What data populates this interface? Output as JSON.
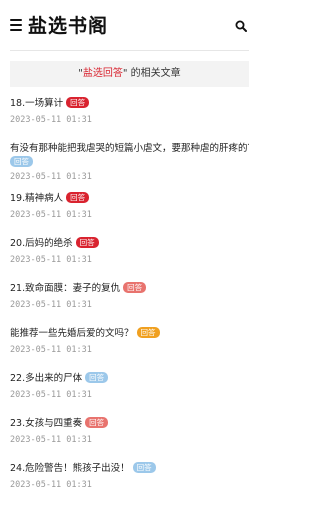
{
  "header": {
    "title": "盐选书阁"
  },
  "banner": {
    "prefix": "\"",
    "keyword": "盐选回答",
    "suffix": "\" 的相关文章"
  },
  "items": [
    {
      "title": "18.一场算计",
      "badge": "回答",
      "badge_color": "#d9232f",
      "date": "2023-05-11 01:31"
    },
    {
      "title": "有没有那种能把我虐哭的短篇小虐文，要那种虐的肝疼的？",
      "badge": "回答",
      "badge_color": "#9cc8ea",
      "date": "2023-05-11 01:31"
    },
    {
      "title": "19.精神病人",
      "badge": "回答",
      "badge_color": "#d9232f",
      "date": "2023-05-11 01:31"
    },
    {
      "title": "20.后妈的绝杀",
      "badge": "回答",
      "badge_color": "#d9232f",
      "date": "2023-05-11 01:31"
    },
    {
      "title": "21.致命面膜：妻子的复仇",
      "badge": "回答",
      "badge_color": "#e8736e",
      "date": "2023-05-11 01:31"
    },
    {
      "title": "能推荐一些先婚后爱的文吗？",
      "badge": "回答",
      "badge_color": "#f0a020",
      "date": "2023-05-11 01:31"
    },
    {
      "title": "22.多出来的尸体",
      "badge": "回答",
      "badge_color": "#9cc8ea",
      "date": "2023-05-11 01:31"
    },
    {
      "title": "23.女孩与四重奏",
      "badge": "回答",
      "badge_color": "#e8736e",
      "date": "2023-05-11 01:31"
    },
    {
      "title": "24.危险警告！熊孩子出没！",
      "badge": "回答",
      "badge_color": "#9cc8ea",
      "date": "2023-05-11 01:31"
    }
  ]
}
